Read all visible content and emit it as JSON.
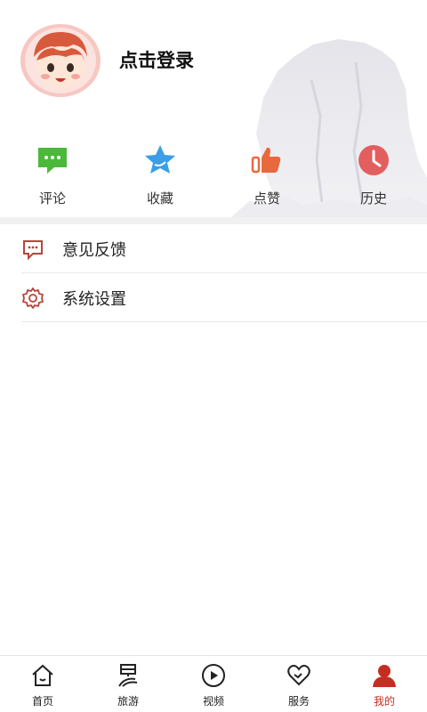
{
  "profile": {
    "login_label": "点击登录"
  },
  "quick_actions": [
    {
      "label": "评论",
      "icon": "comment-icon",
      "color": "#4cb83a"
    },
    {
      "label": "收藏",
      "icon": "star-icon",
      "color": "#3a9ee8"
    },
    {
      "label": "点赞",
      "icon": "thumbs-up-icon",
      "color": "#e9683d"
    },
    {
      "label": "历史",
      "icon": "clock-icon",
      "color": "#e35e5e"
    }
  ],
  "menu": [
    {
      "label": "意见反馈",
      "icon": "feedback-icon"
    },
    {
      "label": "系统设置",
      "icon": "settings-gear-icon"
    }
  ],
  "tabbar": [
    {
      "label": "首页",
      "icon": "home-icon"
    },
    {
      "label": "旅游",
      "icon": "travel-icon"
    },
    {
      "label": "视频",
      "icon": "play-icon"
    },
    {
      "label": "服务",
      "icon": "heart-icon"
    },
    {
      "label": "我的",
      "icon": "user-icon",
      "active": true
    }
  ],
  "colors": {
    "accent": "#c62d22",
    "menu_icon": "#b5453a"
  }
}
